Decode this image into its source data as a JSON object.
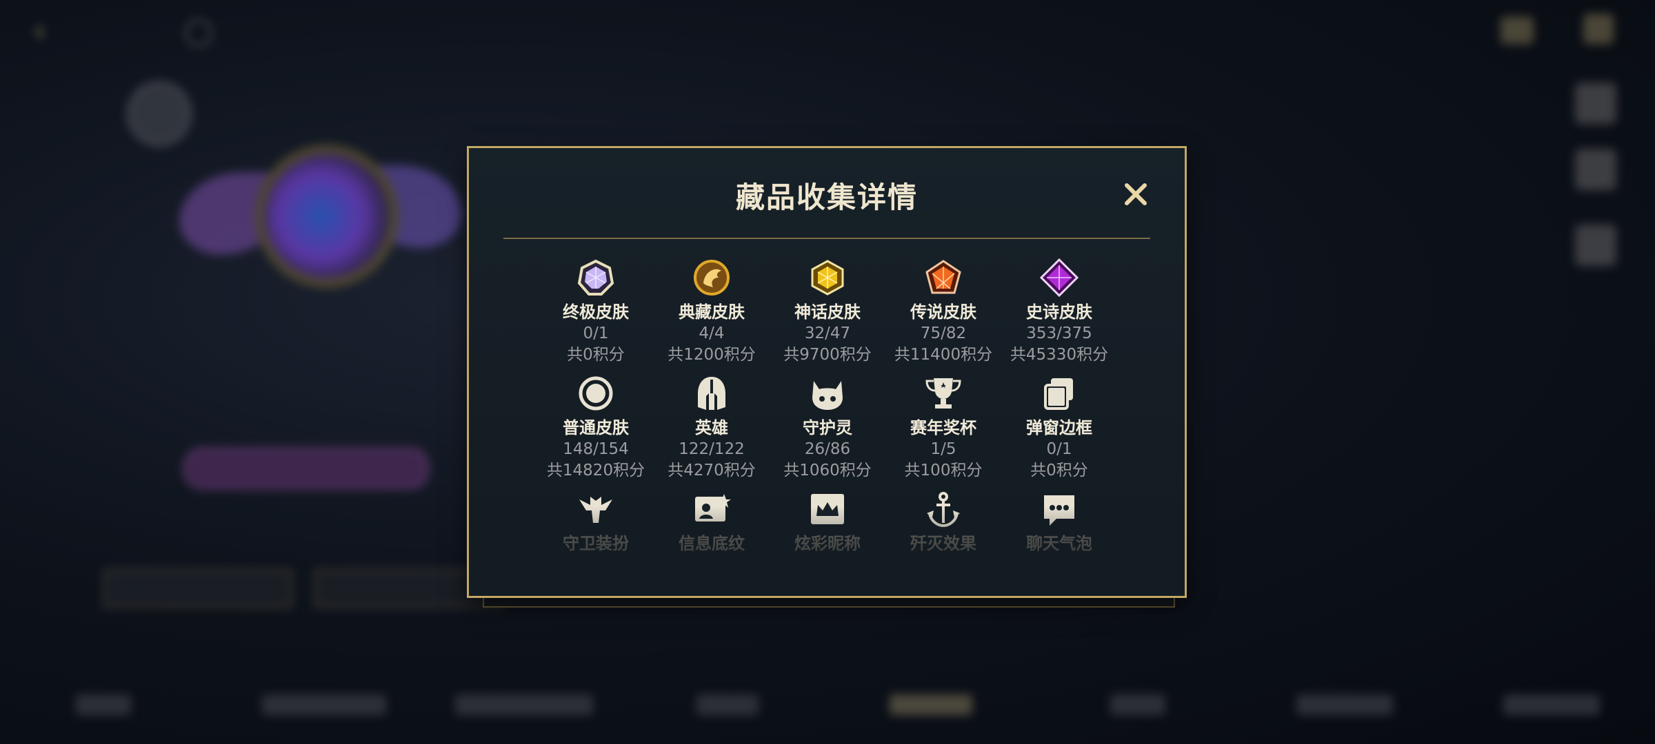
{
  "modal": {
    "title": "藏品收集详情",
    "close_label": "×"
  },
  "collections": [
    {
      "name": "终极皮肤",
      "count": "0/1",
      "points": "共0积分",
      "icon": "ultimate-skin-gem-icon",
      "color": "#c9b6f5"
    },
    {
      "name": "典藏皮肤",
      "count": "4/4",
      "points": "共1200积分",
      "icon": "collection-skin-dragon-icon",
      "color": "#e0a82a"
    },
    {
      "name": "神话皮肤",
      "count": "32/47",
      "points": "共9700积分",
      "icon": "mythic-skin-gem-icon",
      "color": "#f1c21a"
    },
    {
      "name": "传说皮肤",
      "count": "75/82",
      "points": "共11400积分",
      "icon": "legend-skin-gem-icon",
      "color": "#f06a1e"
    },
    {
      "name": "史诗皮肤",
      "count": "353/375",
      "points": "共45330积分",
      "icon": "epic-skin-gem-icon",
      "color": "#b02ad8"
    },
    {
      "name": "普通皮肤",
      "count": "148/154",
      "points": "共14820积分",
      "icon": "normal-skin-ring-icon",
      "color": "#e8e2d2"
    },
    {
      "name": "英雄",
      "count": "122/122",
      "points": "共4270积分",
      "icon": "hero-helmet-icon",
      "color": "#e8e2d2"
    },
    {
      "name": "守护灵",
      "count": "26/86",
      "points": "共1060积分",
      "icon": "guardian-spirit-icon",
      "color": "#e8e2d2"
    },
    {
      "name": "赛年奖杯",
      "count": "1/5",
      "points": "共100积分",
      "icon": "season-trophy-icon",
      "color": "#e8e2d2"
    },
    {
      "name": "弹窗边框",
      "count": "0/1",
      "points": "共0积分",
      "icon": "popup-frame-icon",
      "color": "#e8e2d2"
    }
  ],
  "collections_faded": [
    {
      "name": "守卫装扮",
      "icon": "guard-outfit-icon"
    },
    {
      "name": "信息底纹",
      "icon": "info-background-icon"
    },
    {
      "name": "炫彩昵称",
      "icon": "colorful-nickname-icon"
    },
    {
      "name": "歼灭效果",
      "icon": "elimination-effect-icon"
    },
    {
      "name": "聊天气泡",
      "icon": "chat-bubble-icon"
    }
  ],
  "colors": {
    "gold_border": "#c3a865",
    "modal_bg": "#172128",
    "text_primary": "#efe6cf",
    "text_secondary": "#9c9da0"
  }
}
